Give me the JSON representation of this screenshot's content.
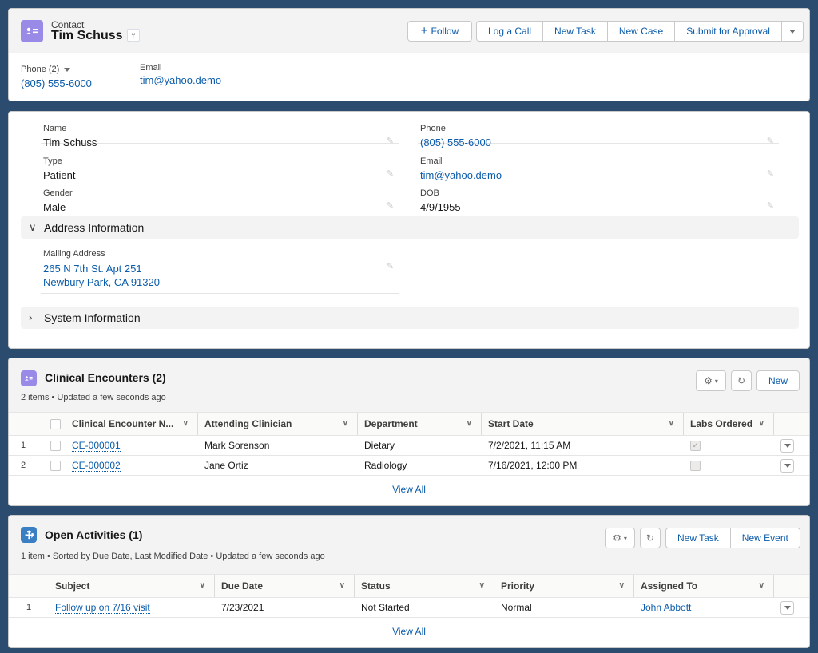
{
  "header": {
    "object_type": "Contact",
    "record_name": "Tim Schuss",
    "icon": "contact-card-icon",
    "actions": {
      "follow": "Follow",
      "group": [
        "Log a Call",
        "New Task",
        "New Case",
        "Submit for Approval"
      ]
    },
    "highlights": {
      "phone_label": "Phone (2)",
      "phone_value": "(805) 555-6000",
      "email_label": "Email",
      "email_value": "tim@yahoo.demo"
    }
  },
  "details": {
    "left_fields": [
      {
        "label": "Name",
        "value": "Tim Schuss"
      },
      {
        "label": "Type",
        "value": "Patient"
      },
      {
        "label": "Gender",
        "value": "Male"
      }
    ],
    "right_fields": [
      {
        "label": "Phone",
        "value": "(805) 555-6000"
      },
      {
        "label": "Email",
        "value": "tim@yahoo.demo"
      },
      {
        "label": "DOB",
        "value": "4/9/1955"
      }
    ],
    "address_section": {
      "title": "Address Information",
      "expanded": true,
      "mailing_label": "Mailing Address",
      "mailing_line1": "265 N 7th St. Apt 251",
      "mailing_line2": "Newbury Park, CA 91320"
    },
    "system_section": {
      "title": "System Information",
      "expanded": false
    }
  },
  "clinical_encounters": {
    "title": "Clinical Encounters (2)",
    "subtitle": "2 items • Updated a few seconds ago",
    "new_label": "New",
    "columns": [
      "Clinical Encounter N...",
      "Attending Clinician",
      "Department",
      "Start Date",
      "Labs Ordered"
    ],
    "rows": [
      {
        "num": "1",
        "id": "CE-000001",
        "clinician": "Mark Sorenson",
        "department": "Dietary",
        "start": "7/2/2021, 11:15 AM",
        "labs": true
      },
      {
        "num": "2",
        "id": "CE-000002",
        "clinician": "Jane Ortiz",
        "department": "Radiology",
        "start": "7/16/2021, 12:00 PM",
        "labs": false
      }
    ],
    "view_all": "View All"
  },
  "open_activities": {
    "title": "Open Activities (1)",
    "subtitle": "1 item • Sorted by Due Date, Last Modified Date • Updated a few seconds ago",
    "new_task_label": "New Task",
    "new_event_label": "New Event",
    "columns": [
      "Subject",
      "Due Date",
      "Status",
      "Priority",
      "Assigned To"
    ],
    "rows": [
      {
        "num": "1",
        "subject": "Follow up on 7/16 visit",
        "due": "7/23/2021",
        "status": "Not Started",
        "priority": "Normal",
        "assigned": "John Abbott"
      }
    ],
    "view_all": "View All"
  }
}
